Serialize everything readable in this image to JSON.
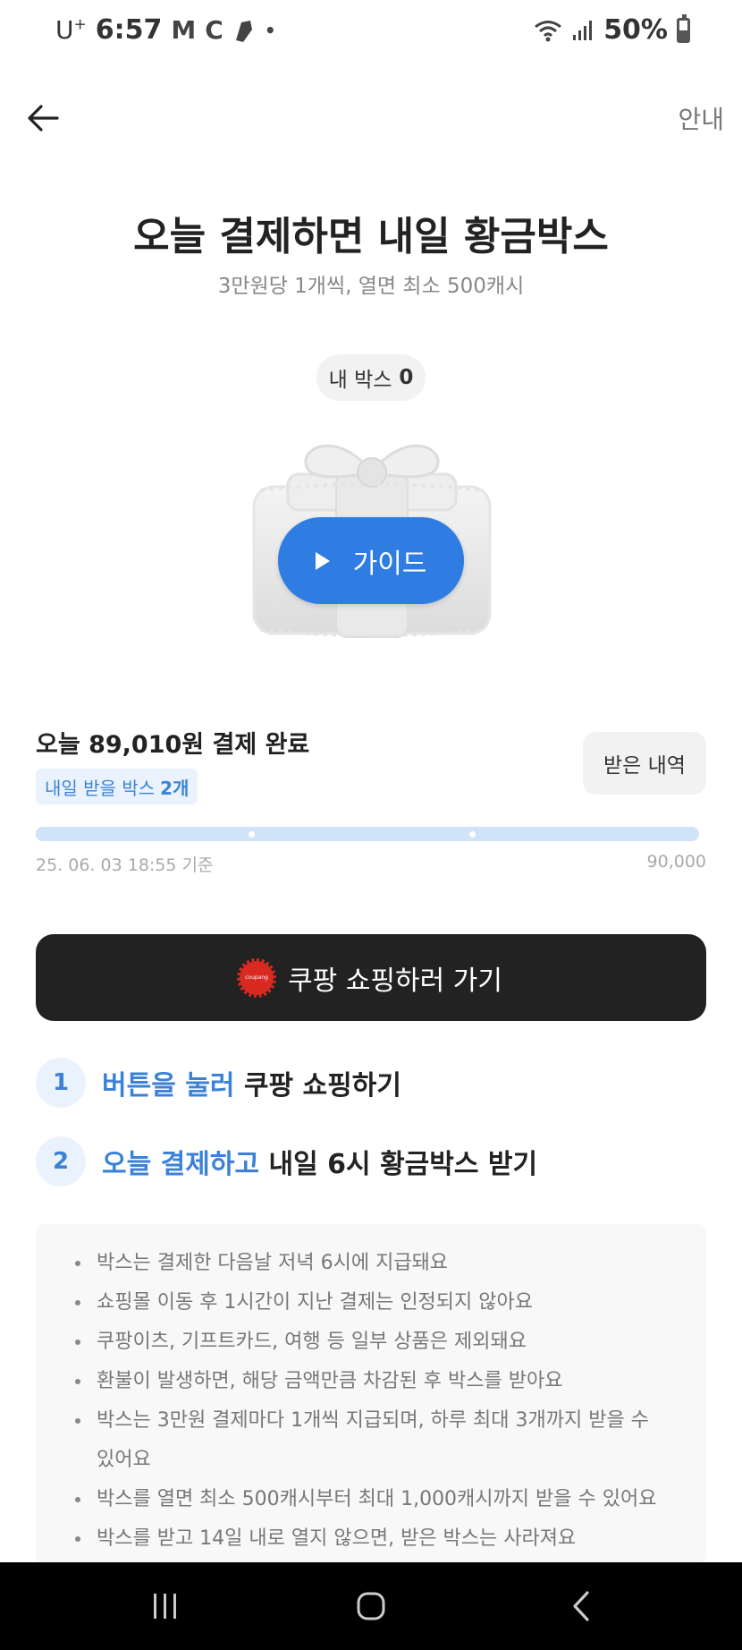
{
  "status_bar": {
    "carrier": "U",
    "carrier_sup": "+",
    "time": "6:57",
    "notif_m": "M",
    "notif_c": "C",
    "notif_dot": "•",
    "battery": "50%",
    "battery_level": 0.5
  },
  "header": {
    "info_label": "안내"
  },
  "hero": {
    "title": "오늘 결제하면 내일 황금박스",
    "subtitle": "3만원당 1개씩, 열면 최소 500캐시",
    "my_box_label": "내 박스",
    "my_box_count": "0",
    "guide_label": "가이드"
  },
  "payment": {
    "paid_text": "오늘 89,010원 결제 완료",
    "tomorrow_label": "내일 받을 박스",
    "tomorrow_count": "2개",
    "history_label": "받은 내역",
    "progress_timestamp": "25. 06. 03 18:55 기준",
    "progress_max": "90,000",
    "progress_value": 89010,
    "progress_max_value": 90000
  },
  "shop_button": {
    "label": "쿠팡 쇼핑하러 가기",
    "logo_text": "coupang"
  },
  "steps": [
    {
      "num": "1",
      "accent": "버튼을 눌러",
      "rest": "쿠팡 쇼핑하기"
    },
    {
      "num": "2",
      "accent": "오늘 결제하고",
      "rest": "내일 6시 황금박스 받기"
    }
  ],
  "notices": [
    "박스는 결제한 다음날 저녁 6시에 지급돼요",
    "쇼핑몰 이동 후 1시간이 지난 결제는 인정되지 않아요",
    "쿠팡이츠, 기프트카드, 여행 등 일부 상품은 제외돼요",
    "환불이 발생하면, 해당 금액만큼 차감된 후 박스를 받아요",
    "박스는 3만원 결제마다 1개씩 지급되며, 하루 최대 3개까지 받을 수 있어요",
    "박스를 열면 최소 500캐시부터 최대 1,000캐시까지 받을 수 있어요",
    "박스를 받고 14일 내로 열지 않으면, 받은 박스는 사라져요"
  ],
  "colors": {
    "accent": "#3b82d6",
    "guide_button": "#2f7de3",
    "shop_button": "#222222",
    "coupang_red": "#d82a20"
  }
}
